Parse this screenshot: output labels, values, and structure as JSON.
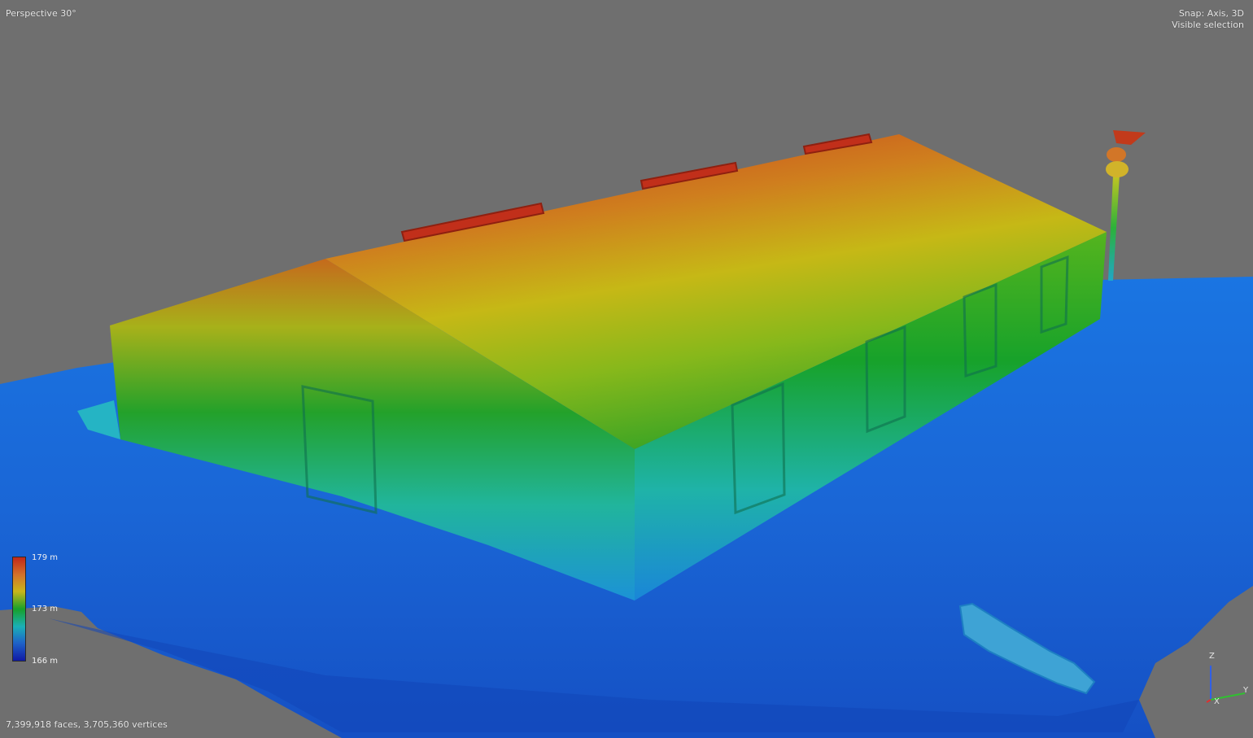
{
  "viewport": {
    "view_mode": "Perspective 30°",
    "snap_mode": "Snap: Axis, 3D",
    "selection_mode": "Visible selection",
    "stats": "7,399,918 faces, 3,705,360 vertices"
  },
  "legend": {
    "max_label": "179 m",
    "mid_label": "173 m",
    "min_label": "166 m",
    "colors": [
      "#c0281a",
      "#d3722a",
      "#c8b61a",
      "#18a12a",
      "#1ab0b7",
      "#1e62c8",
      "#101aa6"
    ]
  },
  "axes": {
    "z_label": "Z",
    "x_label": "X",
    "y_label": "Y",
    "z_color": "#3060e8",
    "x_color": "#e03030",
    "y_color": "#30c030"
  },
  "scene": {
    "colors": {
      "background": "#6f6f6f",
      "ground": "#1b6bde",
      "ground_dark": "#1348bd",
      "roof_high": "#c6391d",
      "roof_mid": "#bfbf12",
      "wall_low": "#23b3c4",
      "wall_mid": "#159c26"
    }
  }
}
